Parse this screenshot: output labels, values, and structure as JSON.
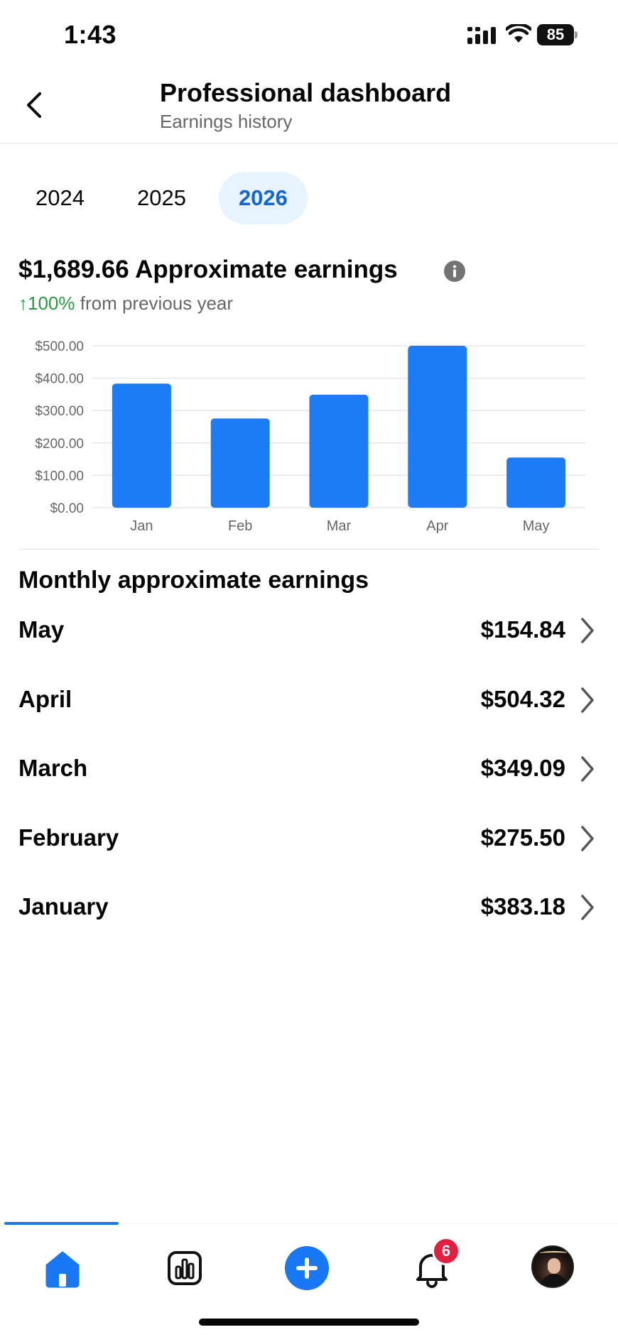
{
  "status_bar": {
    "time": "1:43",
    "battery": "85"
  },
  "header": {
    "title": "Professional dashboard",
    "subtitle": "Earnings history"
  },
  "year_tabs": [
    {
      "label": "2024",
      "active": false
    },
    {
      "label": "2025",
      "active": false
    },
    {
      "label": "2026",
      "active": true
    }
  ],
  "summary": {
    "title": "$1,689.66 Approximate earnings",
    "change_arrow": "↑",
    "change_percent": "100%",
    "change_text": "from previous year"
  },
  "chart_data": {
    "type": "bar",
    "categories": [
      "Jan",
      "Feb",
      "Mar",
      "Apr",
      "May"
    ],
    "values": [
      383.18,
      275.5,
      349.09,
      504.32,
      154.84
    ],
    "y_ticks": [
      "$500.00",
      "$400.00",
      "$300.00",
      "$200.00",
      "$100.00",
      "$0.00"
    ],
    "ylim": [
      0,
      500
    ],
    "bar_color": "#1c7cf6",
    "grid": true
  },
  "monthly": {
    "title": "Monthly approximate earnings",
    "items": [
      {
        "month": "May",
        "amount": "$154.84"
      },
      {
        "month": "April",
        "amount": "$504.32"
      },
      {
        "month": "March",
        "amount": "$349.09"
      },
      {
        "month": "February",
        "amount": "$275.50"
      },
      {
        "month": "January",
        "amount": "$383.18"
      }
    ]
  },
  "bottom_nav": {
    "items": [
      "home-icon",
      "insights-icon",
      "create-icon",
      "notifications-icon",
      "profile-avatar"
    ],
    "notification_count": "6",
    "accent_color": "#1877f2"
  }
}
